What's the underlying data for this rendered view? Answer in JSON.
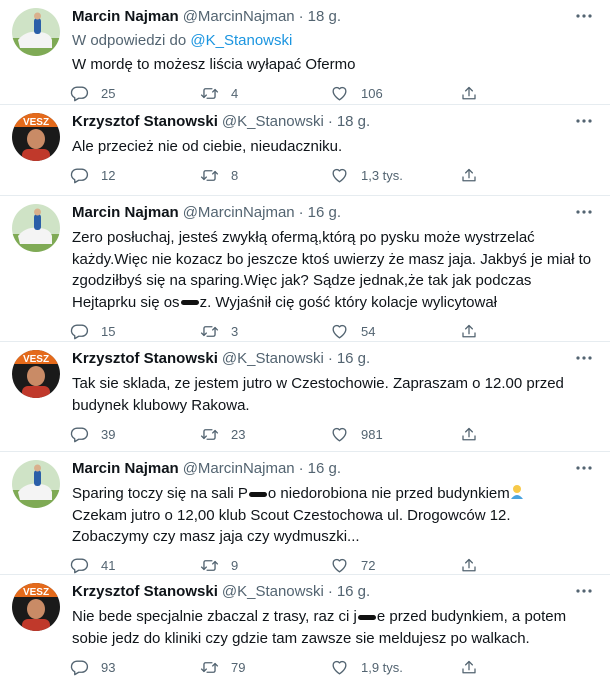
{
  "tweets": [
    {
      "name": "Marcin Najman",
      "handle": "@MarcinNajman",
      "sep": "·",
      "time": "18 g.",
      "reply_prefix": "W odpowiedzi do",
      "reply_to": "@K_Stanowski",
      "body": "W mordę to możesz liścia wyłapać Ofermo",
      "replies": "25",
      "retweets": "4",
      "likes": "106",
      "avatar": "najman"
    },
    {
      "name": "Krzysztof Stanowski",
      "handle": "@K_Stanowski",
      "sep": "·",
      "time": "18 g.",
      "body": "Ale przecież nie od ciebie, nieudaczniku.",
      "replies": "12",
      "retweets": "8",
      "likes": "1,3 tys.",
      "avatar": "stanowski"
    },
    {
      "name": "Marcin Najman",
      "handle": "@MarcinNajman",
      "sep": "·",
      "time": "16 g.",
      "body_a": "Zero posłuchaj, jesteś zwykłą ofermą,którą po pysku może wystrzelać\nkażdy.Więc nie kozacz bo jeszcze ktoś uwierzy że masz jaja. Jakbyś je miał to\nzgodziłbyś się na sparing.Więc jak? Sądze jednak,że tak jak podczas\nHejtaprku się os",
      "body_b": "z. Wyjaśnił cię gość który kolacje wylicytował",
      "replies": "15",
      "retweets": "3",
      "likes": "54",
      "avatar": "najman"
    },
    {
      "name": "Krzysztof Stanowski",
      "handle": "@K_Stanowski",
      "sep": "·",
      "time": "16 g.",
      "body": "Tak sie sklada, ze jestem jutro w Czestochowie. Zapraszam o 12.00 przed\nbudynek klubowy Rakowa.",
      "replies": "39",
      "retweets": "23",
      "likes": "981",
      "avatar": "stanowski"
    },
    {
      "name": "Marcin Najman",
      "handle": "@MarcinNajman",
      "sep": "·",
      "time": "16 g.",
      "body_a": "Sparing toczy się na sali P",
      "body_b": "o niedorobiona nie przed budynkiem",
      "body_c": "Czekam jutro o 12,00 klub Scout Czestochowa ul. Drogowców 12.\nZobaczymy czy masz jaja czy wydmuszki...",
      "replies": "41",
      "retweets": "9",
      "likes": "72",
      "avatar": "najman"
    },
    {
      "name": "Krzysztof Stanowski",
      "handle": "@K_Stanowski",
      "sep": "·",
      "time": "16 g.",
      "body_a": "Nie bede specjalnie zbaczal z trasy, raz ci j",
      "body_b": "e przed budynkiem, a potem\nsobie jedz do kliniki czy gdzie tam zawsze sie meldujesz po walkach.",
      "replies": "93",
      "retweets": "79",
      "likes": "1,9 tys.",
      "avatar": "stanowski"
    }
  ],
  "colors": {
    "link": "#1b95e0",
    "muted": "#536471",
    "text": "#0f1419",
    "divider": "#e6ecf0"
  },
  "icons": [
    "more-icon",
    "reply-icon",
    "retweet-icon",
    "like-icon",
    "share-icon"
  ]
}
